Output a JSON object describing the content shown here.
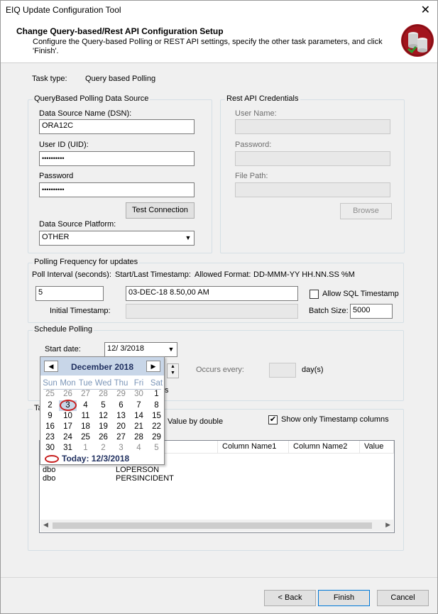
{
  "window": {
    "title": "EIQ Update Configuration Tool",
    "close_glyph": "✕"
  },
  "header": {
    "title": "Change Query-based/Rest API Configuration Setup",
    "description": "Configure the Query-based Polling or REST API settings, specify the other task parameters, and click 'Finish'.",
    "logo_icon": "database-sync-icon"
  },
  "task": {
    "label": "Task type:",
    "value": "Query based Polling"
  },
  "datasource": {
    "legend": "QueryBased Polling Data Source",
    "dsn_label": "Data Source Name (DSN):",
    "dsn_value": "ORA12C",
    "uid_label": "User ID (UID):",
    "uid_value": "••••••••••",
    "password_label": "Password",
    "password_value": "••••••••••",
    "test_button": "Test Connection",
    "platform_label": "Data Source Platform:",
    "platform_value": "OTHER"
  },
  "rest": {
    "legend": "Rest API Credentials",
    "user_label": "User Name:",
    "password_label": "Password:",
    "filepath_label": "File Path:",
    "browse_button": "Browse"
  },
  "polling": {
    "legend": "Polling Frequency for updates",
    "interval_label": "Poll Interval (seconds):",
    "interval_value": "5",
    "timestamp_label": "Start/Last Timestamp:",
    "format_label": "Allowed Format:",
    "format_value": "DD-MMM-YY HH.NN.SS %M",
    "timestamp_value": "03-DEC-18 8.50,00 AM",
    "allow_sql_label": "Allow SQL Timestamp",
    "initial_label": "Initial Timestamp:",
    "batch_label": "Batch Size:",
    "batch_value": "5000"
  },
  "schedule": {
    "legend": "Schedule Polling",
    "start_label": "Start date:",
    "start_value": "12/  3/2018",
    "occurs_label": "Occurs every:",
    "day_unit": "day(s)",
    "hidden_suffix": "s"
  },
  "calendar": {
    "month": "December 2018",
    "prev_glyph": "◀",
    "next_glyph": "▶",
    "weekdays": [
      "Sun",
      "Mon",
      "Tue",
      "Wed",
      "Thu",
      "Fri",
      "Sat"
    ],
    "weeks": [
      [
        "25",
        "26",
        "27",
        "28",
        "29",
        "30",
        "1"
      ],
      [
        "2",
        "3",
        "4",
        "5",
        "6",
        "7",
        "8"
      ],
      [
        "9",
        "10",
        "11",
        "12",
        "13",
        "14",
        "15"
      ],
      [
        "16",
        "17",
        "18",
        "19",
        "20",
        "21",
        "22"
      ],
      [
        "23",
        "24",
        "25",
        "26",
        "27",
        "28",
        "29"
      ],
      [
        "30",
        "31",
        "1",
        "2",
        "3",
        "4",
        "5"
      ]
    ],
    "today_label": "Today: 12/3/2018"
  },
  "tables": {
    "legend_initial": "Ta",
    "value_by_double": "Value by double",
    "show_timestamp_label": "Show only Timestamp columns",
    "columns": [
      "Column Name1",
      "Column Name2",
      "Value"
    ],
    "rows": [
      [
        "dbo",
        "LOPERSON"
      ],
      [
        "dbo",
        "PERSINCIDENT"
      ]
    ]
  },
  "footer": {
    "back": "< Back",
    "finish": "Finish",
    "cancel": "Cancel"
  }
}
